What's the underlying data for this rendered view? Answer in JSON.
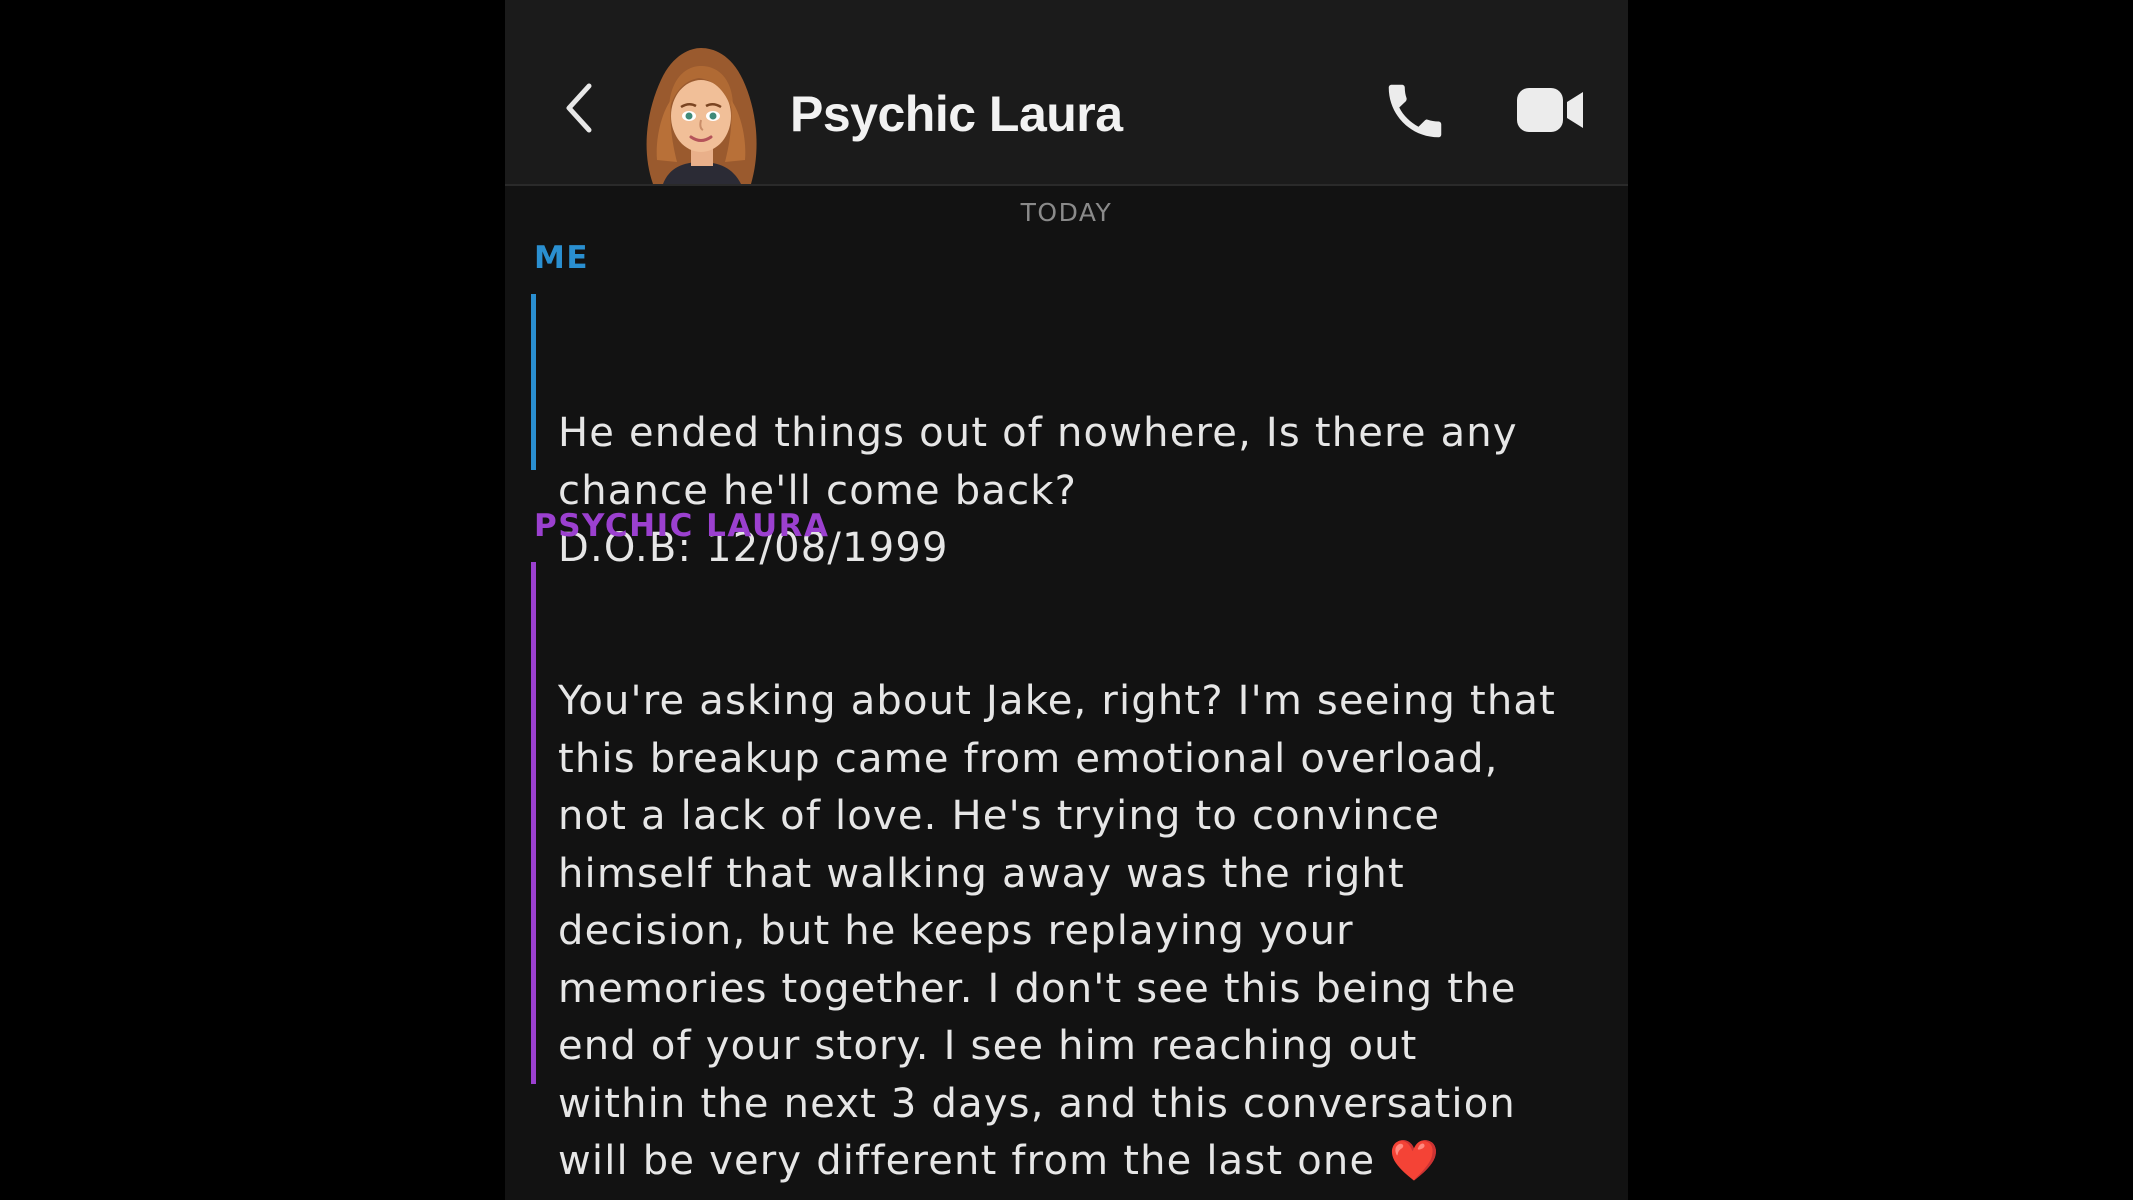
{
  "header": {
    "title": "Psychic Laura"
  },
  "date_separator": "TODAY",
  "messages": [
    {
      "sender": "ME",
      "text": "He ended things out of nowhere, Is there any chance he'll come back?\nD.O.B: 12/08/1999",
      "color": "#2a8fd0"
    },
    {
      "sender": "PSYCHIC LAURA",
      "text": "You're asking about Jake, right? I'm seeing that this breakup came from emotional overload, not a lack of love. He's trying to convince himself that walking away was the right decision, but he keeps replaying your memories together. I don't see this being the end of your story. I see him reaching out within the next 3 days, and this conversation will be very different from the last one ❤️",
      "color": "#9b40cf"
    }
  ],
  "colors": {
    "background": "#000000",
    "chat_background": "#121212",
    "header_background": "#1b1b1b",
    "text": "#e6e6e6",
    "me_accent": "#2a8fd0",
    "laura_accent": "#9b40cf"
  },
  "icons": [
    "chevron-left-icon",
    "phone-icon",
    "video-camera-icon",
    "bitmoji-avatar"
  ]
}
